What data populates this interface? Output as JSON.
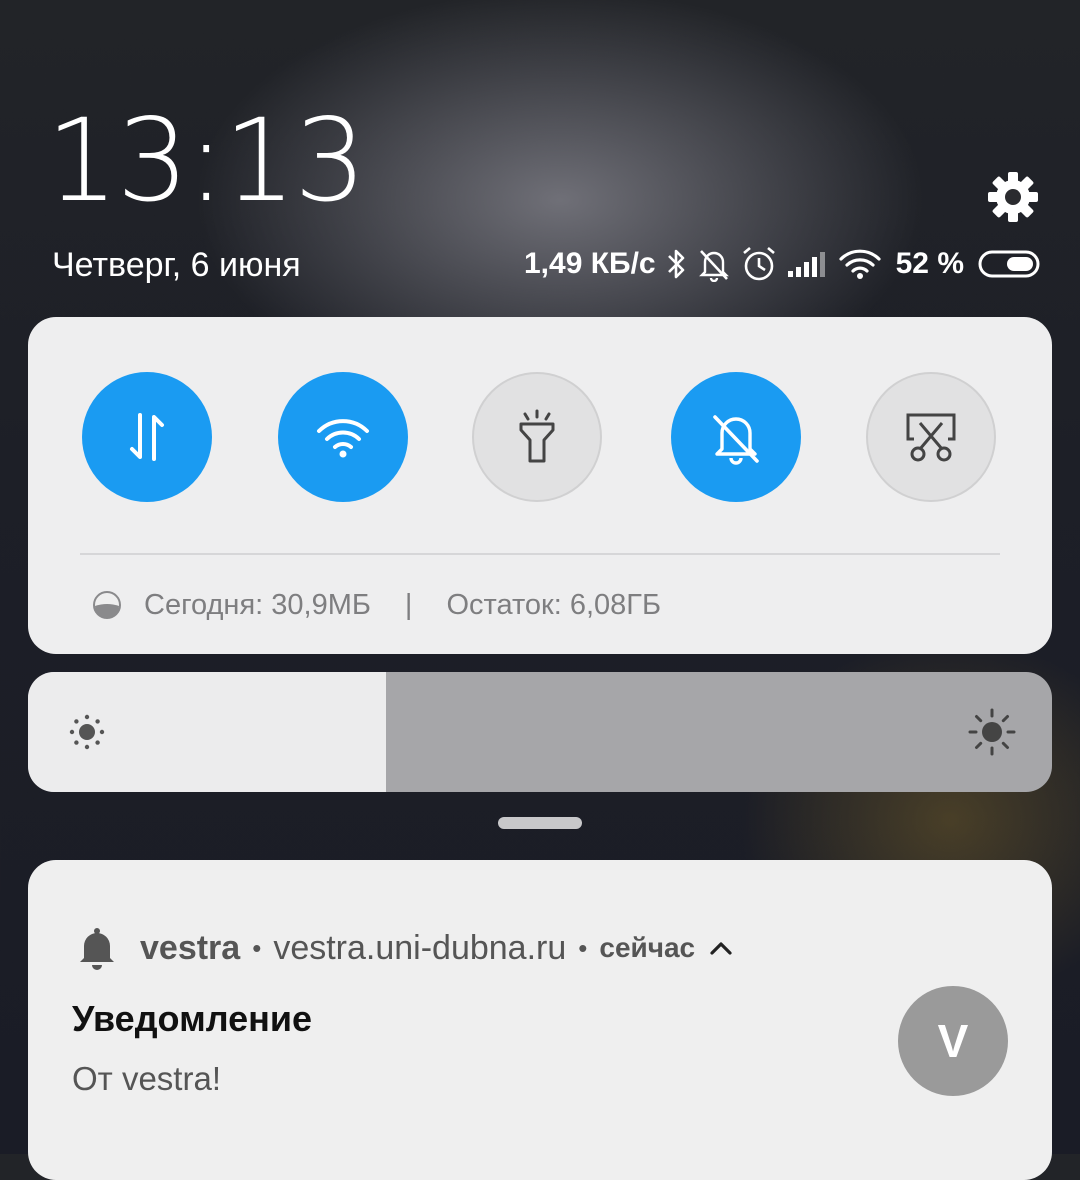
{
  "status_bar": {
    "time": "13:13",
    "date": "Четверг, 6 июня",
    "net_speed": "1,49 КБ/с",
    "battery_percent": "52 %",
    "battery_level": 0.52,
    "icons": [
      "bluetooth-icon",
      "mute-bell-icon",
      "alarm-icon",
      "signal-icon",
      "wifi-icon",
      "battery-icon"
    ]
  },
  "quick_settings": {
    "toggles": [
      {
        "name": "mobile-data",
        "icon": "data-arrows-icon",
        "state": "on"
      },
      {
        "name": "wifi",
        "icon": "wifi-icon",
        "state": "on"
      },
      {
        "name": "flashlight",
        "icon": "flashlight-icon",
        "state": "off"
      },
      {
        "name": "silent",
        "icon": "mute-bell-icon",
        "state": "on"
      },
      {
        "name": "screenshot",
        "icon": "screenshot-scissors-icon",
        "state": "off"
      }
    ],
    "usage_today": "Сегодня: 30,9МБ",
    "usage_separator": "|",
    "usage_remaining": "Остаток: 6,08ГБ",
    "accent_color": "#1a9bf2"
  },
  "brightness": {
    "level": 0.35
  },
  "notification": {
    "app_name": "vestra",
    "dot": "•",
    "site": "vestra.uni-dubna.ru",
    "time": "сейчас",
    "title": "Уведомление",
    "text": "От vestra!",
    "avatar_letter": "V"
  }
}
